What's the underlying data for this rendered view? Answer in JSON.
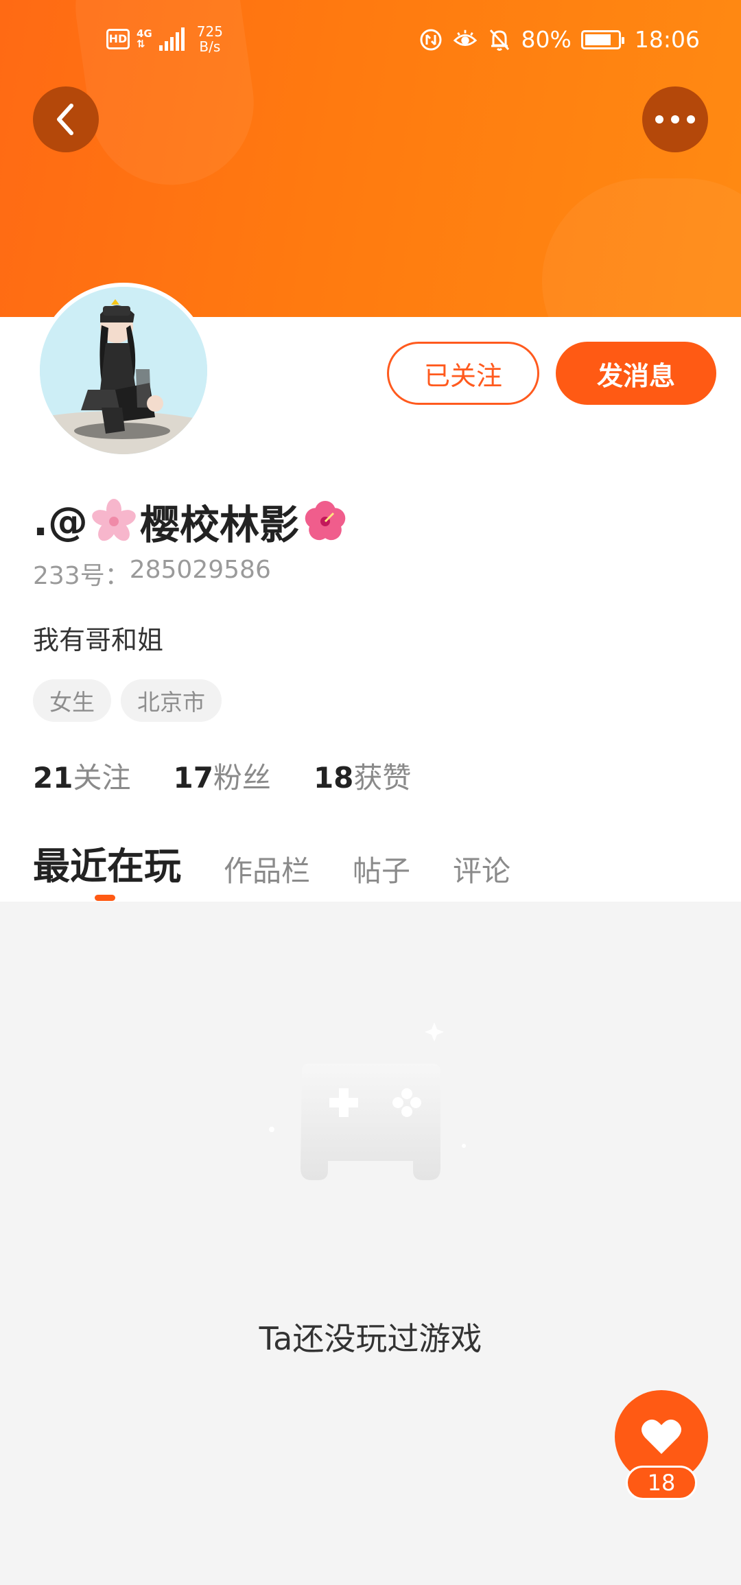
{
  "status_bar": {
    "hd": "HD",
    "network": "4G",
    "speed_value": "725",
    "speed_unit": "B/s",
    "battery_percent": "80%",
    "battery_level": 0.8,
    "time": "18:06",
    "icons": [
      "data-saver-icon",
      "eye-comfort-icon",
      "mute-bell-icon",
      "battery-icon"
    ]
  },
  "header": {
    "back_icon": "chevron-left-icon",
    "more_icon": "more-dots-icon",
    "accent_color": "#ff6a14"
  },
  "profile": {
    "avatar": "anime-character-avatar",
    "followed_label": "已关注",
    "message_label": "发消息",
    "name_prefix": ".@",
    "name_main": "樱校林影",
    "uid_label": "233号：",
    "uid_value": "285029586",
    "bio": "我有哥和姐",
    "tags": [
      "女生",
      "北京市"
    ],
    "stats": [
      {
        "num": "21",
        "label": "关注"
      },
      {
        "num": "17",
        "label": "粉丝"
      },
      {
        "num": "18",
        "label": "获赞"
      }
    ]
  },
  "tabs": [
    {
      "label": "最近在玩",
      "active": true
    },
    {
      "label": "作品栏",
      "active": false
    },
    {
      "label": "帖子",
      "active": false
    },
    {
      "label": "评论",
      "active": false
    }
  ],
  "empty_state": {
    "icon": "gamepad-icon",
    "text": "Ta还没玩过游戏"
  },
  "like": {
    "icon": "heart-icon",
    "count": "18"
  }
}
